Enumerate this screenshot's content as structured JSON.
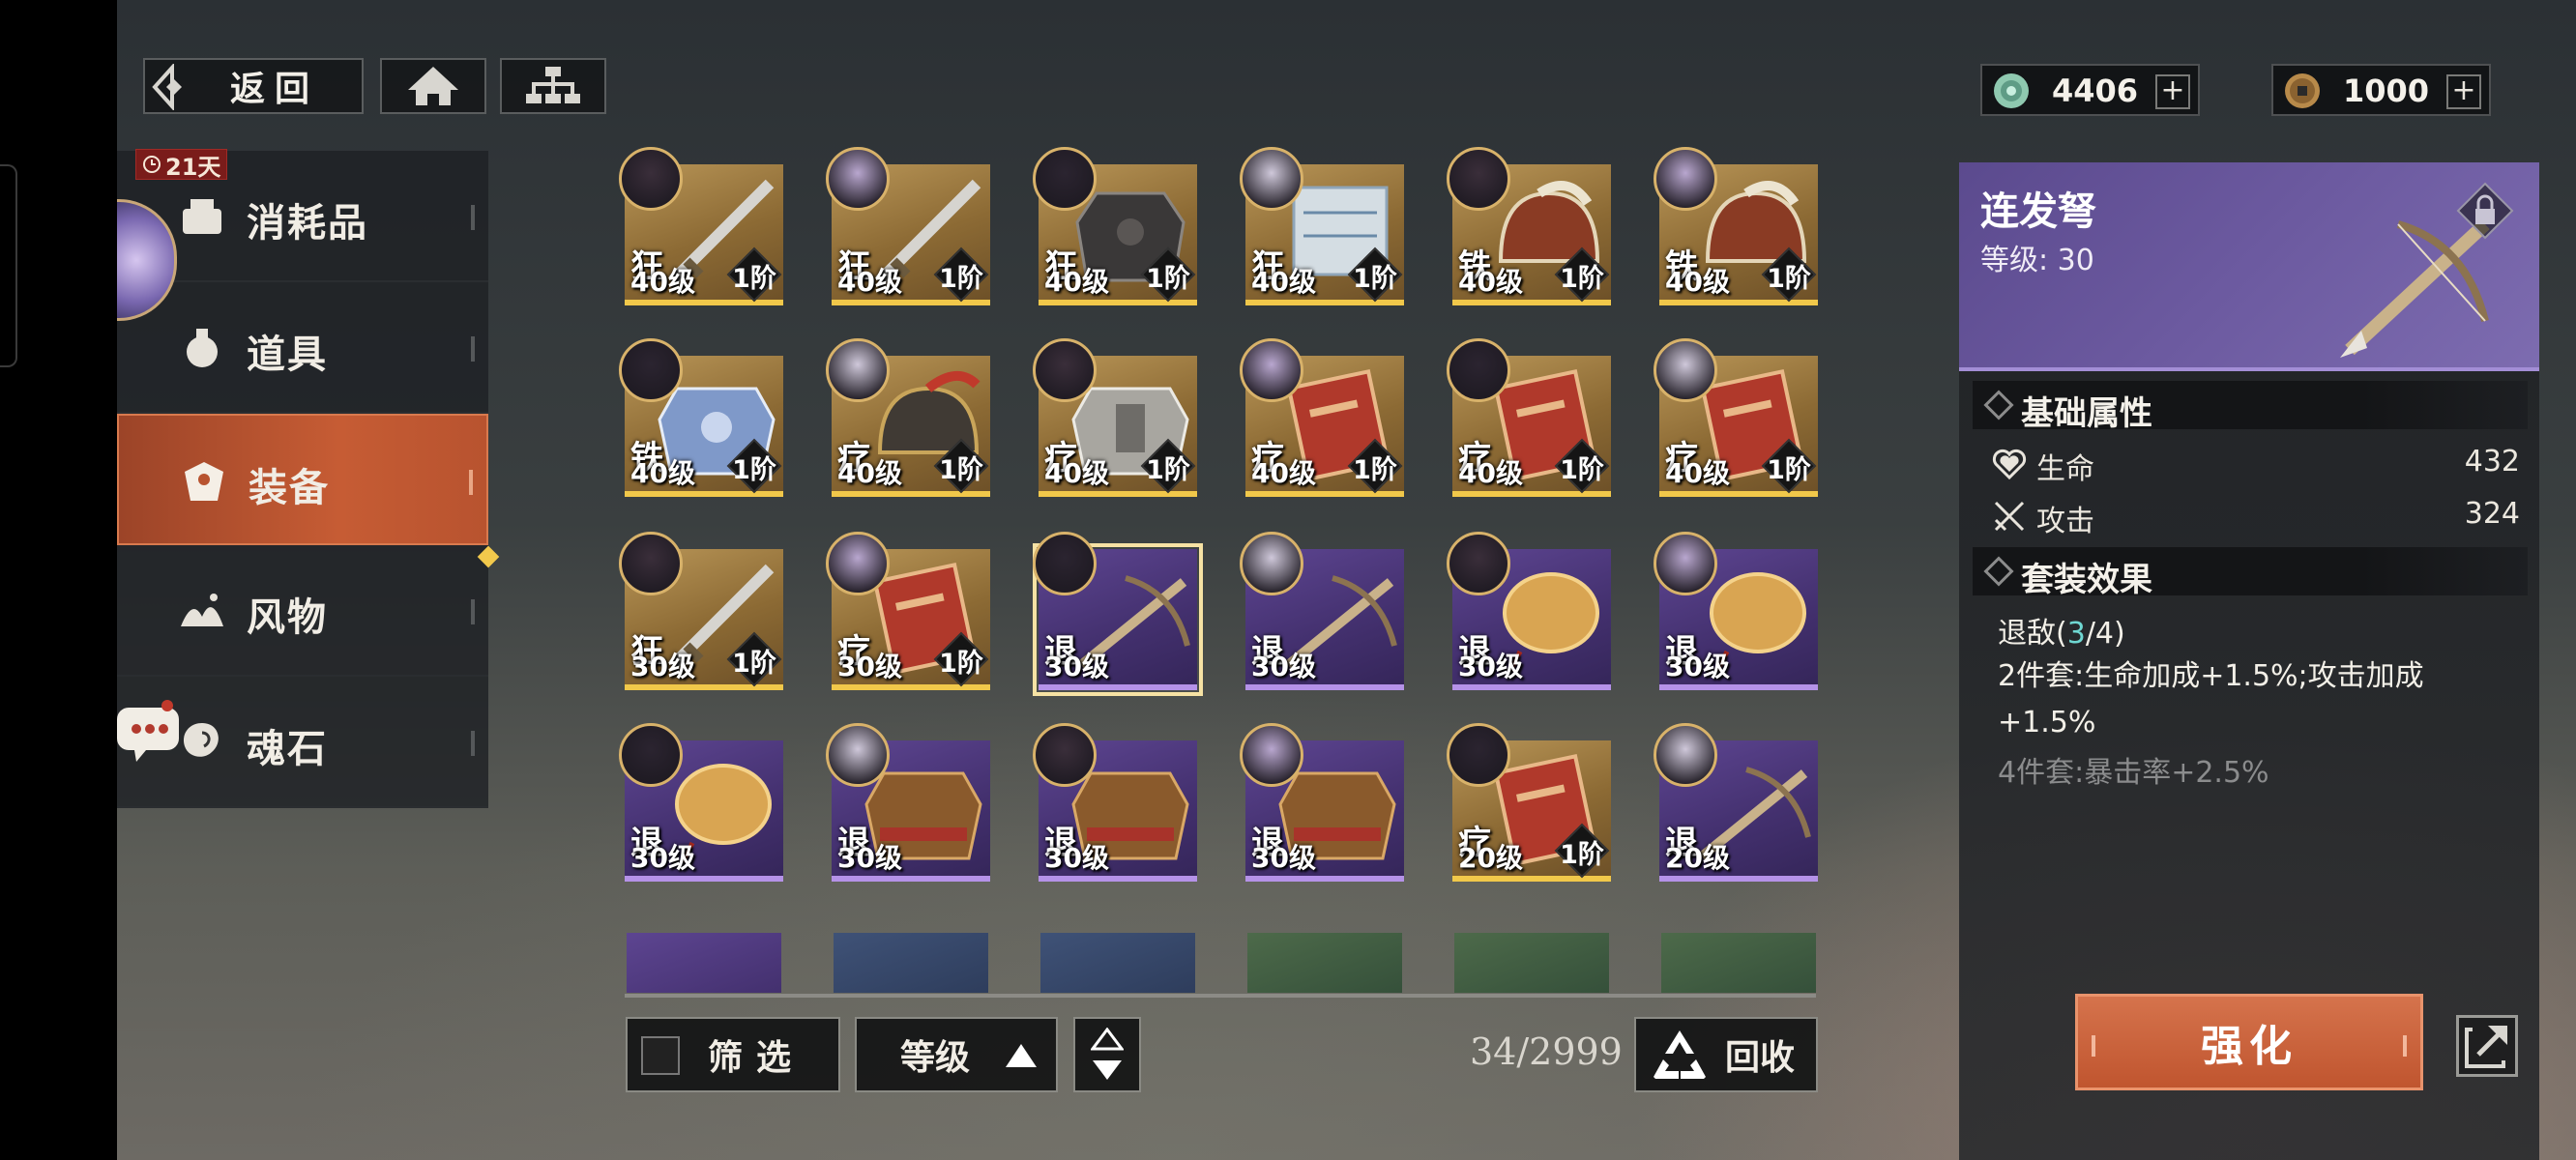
{
  "top": {
    "back_label": "返回",
    "currency": [
      {
        "icon": "jade-coin-icon",
        "value": "4406"
      },
      {
        "icon": "copper-coin-icon",
        "value": "1000"
      }
    ]
  },
  "sidebar": {
    "timer": "21天",
    "items": [
      {
        "label": "消耗品",
        "icon": "consumables-icon"
      },
      {
        "label": "道具",
        "icon": "items-icon"
      },
      {
        "label": "装备",
        "icon": "equipment-icon",
        "active": true
      },
      {
        "label": "风物",
        "icon": "scenery-icon"
      },
      {
        "label": "魂石",
        "icon": "soulstone-icon"
      }
    ]
  },
  "grid": {
    "cards": [
      {
        "tag": "狂",
        "level": "40级",
        "rank": "1阶",
        "rarity": "gold",
        "item": "sword"
      },
      {
        "tag": "狂",
        "level": "40级",
        "rank": "1阶",
        "rarity": "gold",
        "item": "sword"
      },
      {
        "tag": "狂",
        "level": "40级",
        "rank": "1阶",
        "rarity": "gold",
        "item": "armor-dark"
      },
      {
        "tag": "狂",
        "level": "40级",
        "rank": "1阶",
        "rarity": "gold",
        "item": "scroll"
      },
      {
        "tag": "铁",
        "level": "40级",
        "rank": "1阶",
        "rarity": "gold",
        "item": "helmet"
      },
      {
        "tag": "铁",
        "level": "40级",
        "rank": "1阶",
        "rarity": "gold",
        "item": "helmet"
      },
      {
        "tag": "铁",
        "level": "40级",
        "rank": "1阶",
        "rarity": "gold",
        "item": "armor-blue"
      },
      {
        "tag": "疗",
        "level": "40级",
        "rank": "1阶",
        "rarity": "gold",
        "item": "helmet-red"
      },
      {
        "tag": "疗",
        "level": "40级",
        "rank": "1阶",
        "rarity": "gold",
        "item": "armor-silver"
      },
      {
        "tag": "疗",
        "level": "40级",
        "rank": "1阶",
        "rarity": "gold",
        "item": "book"
      },
      {
        "tag": "疗",
        "level": "40级",
        "rank": "1阶",
        "rarity": "gold",
        "item": "book"
      },
      {
        "tag": "疗",
        "level": "40级",
        "rank": "1阶",
        "rarity": "gold",
        "item": "book"
      },
      {
        "tag": "狂",
        "level": "30级",
        "rank": "1阶",
        "rarity": "gold",
        "item": "sword"
      },
      {
        "tag": "疗",
        "level": "30级",
        "rank": "1阶",
        "rarity": "gold",
        "item": "book"
      },
      {
        "tag": "退",
        "level": "30级",
        "rank": "",
        "rarity": "purple",
        "item": "crossbow",
        "selected": true
      },
      {
        "tag": "退",
        "level": "30级",
        "rank": "",
        "rarity": "purple",
        "item": "crossbow"
      },
      {
        "tag": "退",
        "level": "30级",
        "rank": "",
        "rarity": "purple",
        "item": "mirror"
      },
      {
        "tag": "退",
        "level": "30级",
        "rank": "",
        "rarity": "purple",
        "item": "mirror"
      },
      {
        "tag": "退",
        "level": "30级",
        "rank": "",
        "rarity": "purple",
        "item": "mirror"
      },
      {
        "tag": "退",
        "level": "30级",
        "rank": "",
        "rarity": "purple",
        "item": "armor-bronze"
      },
      {
        "tag": "退",
        "level": "30级",
        "rank": "",
        "rarity": "purple",
        "item": "armor-bronze"
      },
      {
        "tag": "退",
        "level": "30级",
        "rank": "",
        "rarity": "purple",
        "item": "armor-bronze"
      },
      {
        "tag": "疗",
        "level": "20级",
        "rank": "1阶",
        "rarity": "gold",
        "item": "book"
      },
      {
        "tag": "退",
        "level": "20级",
        "rank": "",
        "rarity": "purple",
        "item": "crossbow"
      }
    ],
    "partial_row": [
      "purple",
      "blue",
      "blue",
      "green",
      "green",
      "green"
    ]
  },
  "bottom": {
    "filter_label": "筛选",
    "sort_label": "等级",
    "count": "34/2999",
    "recycle_label": "回收"
  },
  "detail": {
    "name": "连发弩",
    "level_label": "等级:",
    "level_value": "30",
    "base_title": "基础属性",
    "stats": [
      {
        "name": "生命",
        "value": "432",
        "icon": "heart-icon"
      },
      {
        "name": "攻击",
        "value": "324",
        "icon": "crossed-swords-icon"
      }
    ],
    "set_title": "套装效果",
    "set_name_prefix": "退敌(",
    "set_count": "3",
    "set_name_suffix": "/4)",
    "set_2": "2件套:生命加成+1.5%;攻击加成+1.5%",
    "set_4": "4件套:暴击率+2.5%",
    "enhance_label": "强化"
  },
  "colors": {
    "accent": "#c65c34",
    "gold_frame": "#f1c84a",
    "purple_frame": "#b592e8",
    "set_active": "#6fd7d2"
  }
}
